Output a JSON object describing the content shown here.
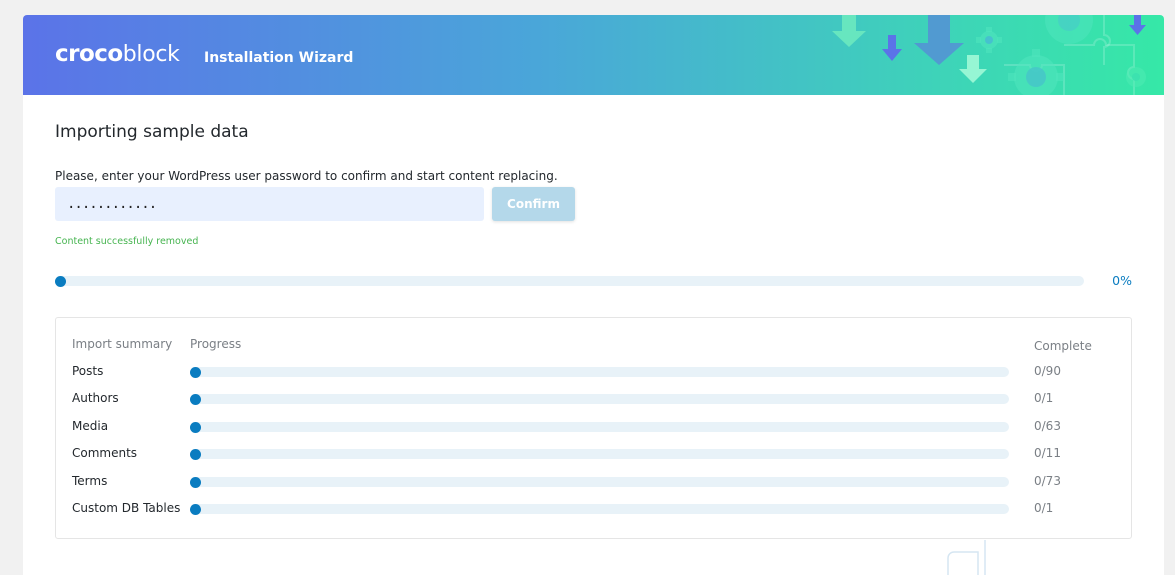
{
  "header": {
    "logo_bold": "croco",
    "logo_light": "block",
    "title": "Installation Wizard",
    "gradient_start": "#5b73e8",
    "gradient_end": "#36e8a7"
  },
  "main": {
    "title": "Importing sample data",
    "instruction": "Please, enter your WordPress user password to confirm and start content replacing.",
    "password_value": "............",
    "confirm_label": "Confirm",
    "status_message": "Content successfully removed",
    "overall_progress_text": "0%",
    "overall_progress": 0
  },
  "summary": {
    "col_import": "Import summary",
    "col_progress": "Progress",
    "col_complete": "Complete",
    "rows": [
      {
        "label": "Posts",
        "complete": "0/90",
        "progress": 0
      },
      {
        "label": "Authors",
        "complete": "0/1",
        "progress": 0
      },
      {
        "label": "Media",
        "complete": "0/63",
        "progress": 0
      },
      {
        "label": "Comments",
        "complete": "0/11",
        "progress": 0
      },
      {
        "label": "Terms",
        "complete": "0/73",
        "progress": 0
      },
      {
        "label": "Custom DB Tables",
        "complete": "0/1",
        "progress": 0
      }
    ]
  },
  "colors": {
    "accent": "#0a7cc0",
    "success": "#46b450",
    "button_disabled": "#b4d8ea"
  },
  "icons": [
    "gear-icon",
    "arrow-down-icon",
    "puzzle-icon"
  ]
}
